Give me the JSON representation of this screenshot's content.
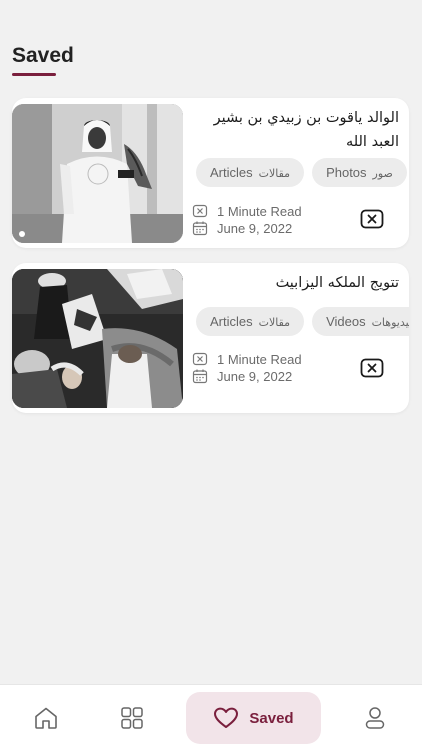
{
  "header": {
    "title": "Saved"
  },
  "cards": [
    {
      "title": "الوالد ياقوت بن زبيدي بن بشير العبد الله",
      "tags": [
        {
          "label": "Articles",
          "label_ar": "مقالات"
        },
        {
          "label": "Photos",
          "label_ar": "صور"
        }
      ],
      "read_time": "1 Minute Read",
      "date": "June 9, 2022"
    },
    {
      "title": "تتويج الملكه اليزابيث",
      "tags": [
        {
          "label": "Articles",
          "label_ar": "مقالات"
        },
        {
          "label": "Videos",
          "label_ar": "فيديوهات"
        }
      ],
      "read_time": "1 Minute Read",
      "date": "June 9, 2022"
    }
  ],
  "nav": {
    "items": [
      {
        "name": "home",
        "icon": "home-icon"
      },
      {
        "name": "categories",
        "icon": "grid-icon"
      },
      {
        "name": "saved",
        "icon": "heart-icon",
        "label": "Saved"
      },
      {
        "name": "profile",
        "icon": "user-icon"
      }
    ]
  },
  "colors": {
    "accent": "#7a1f3d",
    "accent_bg": "#f2e4e9",
    "background": "#f1f1f1"
  }
}
